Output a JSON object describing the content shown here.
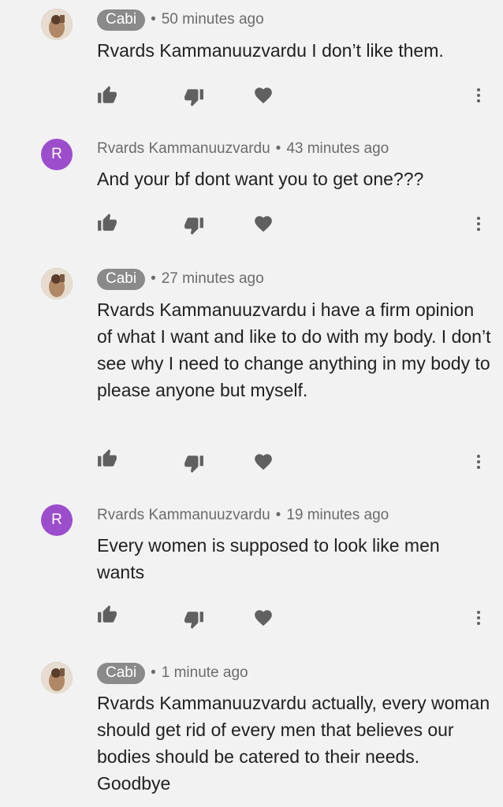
{
  "comments": [
    {
      "author": "Cabi",
      "is_creator": true,
      "avatar": "photo",
      "time": "50 minutes ago",
      "text": "Rvards Kammanuuzvardu I don’t like them."
    },
    {
      "author": "Rvards Kammanuuzvardu",
      "is_creator": false,
      "avatar": "R",
      "avatar_color": "#9c4dcc",
      "time": "43 minutes ago",
      "text": "And your bf dont want you to get one???"
    },
    {
      "author": "Cabi",
      "is_creator": true,
      "avatar": "photo",
      "time": "27 minutes ago",
      "text": "Rvards Kammanuuzvardu i have a firm opinion of what I want and like to do with my body. I don’t see why I need to change anything in my body to please anyone but myself."
    },
    {
      "author": "Rvards Kammanuuzvardu",
      "is_creator": false,
      "avatar": "R",
      "avatar_color": "#9c4dcc",
      "time": "19 minutes ago",
      "text": "Every women is supposed to look like men wants"
    },
    {
      "author": "Cabi",
      "is_creator": true,
      "avatar": "photo",
      "time": "1 minute ago",
      "text": "Rvards Kammanuuzvardu actually, every woman should get rid of every men that believes our bodies should be catered to their needs. Goodbye"
    }
  ],
  "separator": "•",
  "icons": {
    "like": "thumb-up-icon",
    "dislike": "thumb-down-icon",
    "heart": "heart-icon",
    "more": "more-vert-icon"
  },
  "colors": {
    "background": "#f2f2f2",
    "creator_badge": "#8a8a8a",
    "icon": "#606060",
    "avatar_r": "#9c4dcc"
  }
}
